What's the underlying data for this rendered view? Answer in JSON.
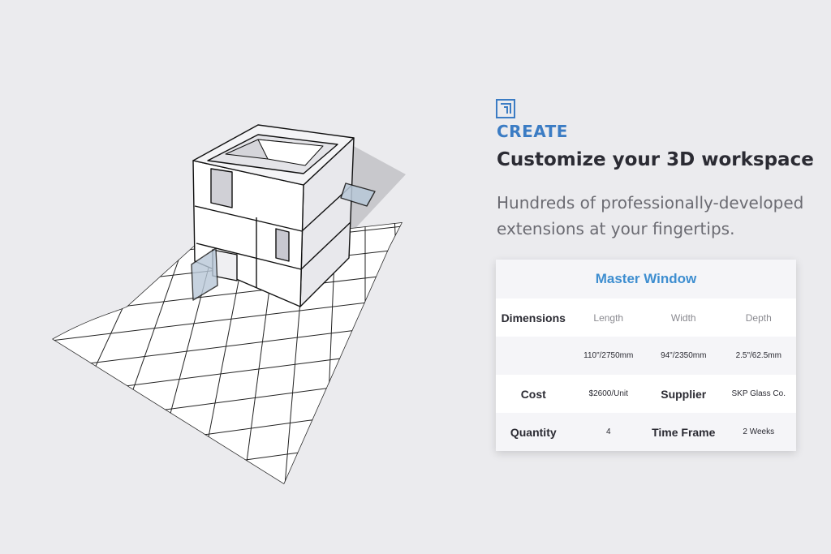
{
  "section": {
    "icon": "blueprint-icon",
    "label": "CREATE",
    "headline": "Customize your 3D workspace",
    "subtext": "Hundreds of professionally-developed extensions at your fingertips."
  },
  "card": {
    "title": "Master Window",
    "dimensions_label": "Dimensions",
    "columns": [
      "Length",
      "Width",
      "Depth"
    ],
    "values": [
      "110\"/2750mm",
      "94\"/2350mm",
      "2.5\"/62.5mm"
    ],
    "cost_label": "Cost",
    "cost_value": "$2600/Unit",
    "supplier_label": "Supplier",
    "supplier_value": "SKP Glass Co.",
    "quantity_label": "Quantity",
    "quantity_value": "4",
    "timeframe_label": "Time Frame",
    "timeframe_value": "2 Weeks"
  },
  "colors": {
    "accent": "#3b7cc4",
    "card_title": "#3e8ed0",
    "background": "#ebebee"
  }
}
